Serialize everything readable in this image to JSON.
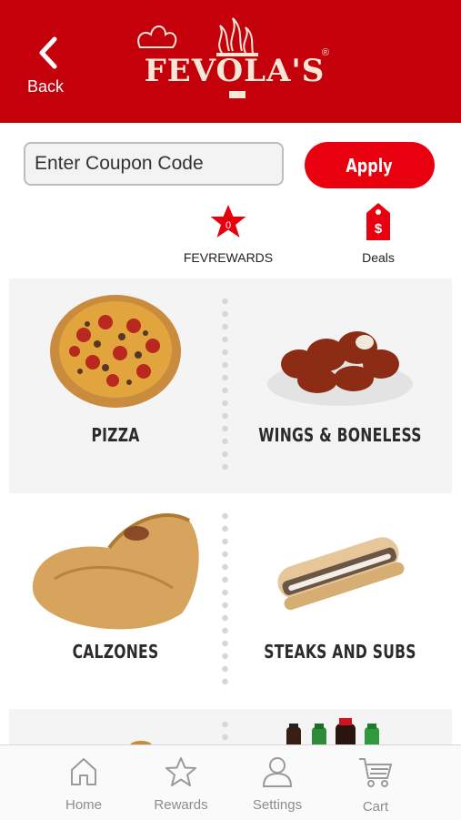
{
  "header": {
    "back_label": "Back",
    "logo_text": "FEVOLA'S",
    "logo_reg": "®",
    "brand_color": "#c4000a"
  },
  "coupon": {
    "placeholder": "Enter Coupon Code",
    "value": "",
    "apply_label": "Apply",
    "apply_color": "#e8000e"
  },
  "quick_links": {
    "rewards": {
      "icon": "star-badge-icon",
      "count": "0",
      "label": "FEVREWARDS"
    },
    "deals": {
      "icon": "price-tag-icon",
      "label": "Deals"
    }
  },
  "categories": [
    {
      "label": "PIZZA",
      "icon": "pizza-image"
    },
    {
      "label": "WINGS & BONELESS",
      "icon": "wings-image"
    },
    {
      "label": "CALZONES",
      "icon": "calzone-image"
    },
    {
      "label": "STEAKS AND SUBS",
      "icon": "sub-sandwich-image"
    },
    {
      "label": "",
      "icon": "dessert-image"
    },
    {
      "label": "",
      "icon": "drinks-image"
    }
  ],
  "tabbar": {
    "items": [
      {
        "label": "Home",
        "icon": "home-icon"
      },
      {
        "label": "Rewards",
        "icon": "star-icon"
      },
      {
        "label": "Settings",
        "icon": "person-icon"
      },
      {
        "label": "Cart",
        "icon": "cart-icon"
      }
    ]
  }
}
